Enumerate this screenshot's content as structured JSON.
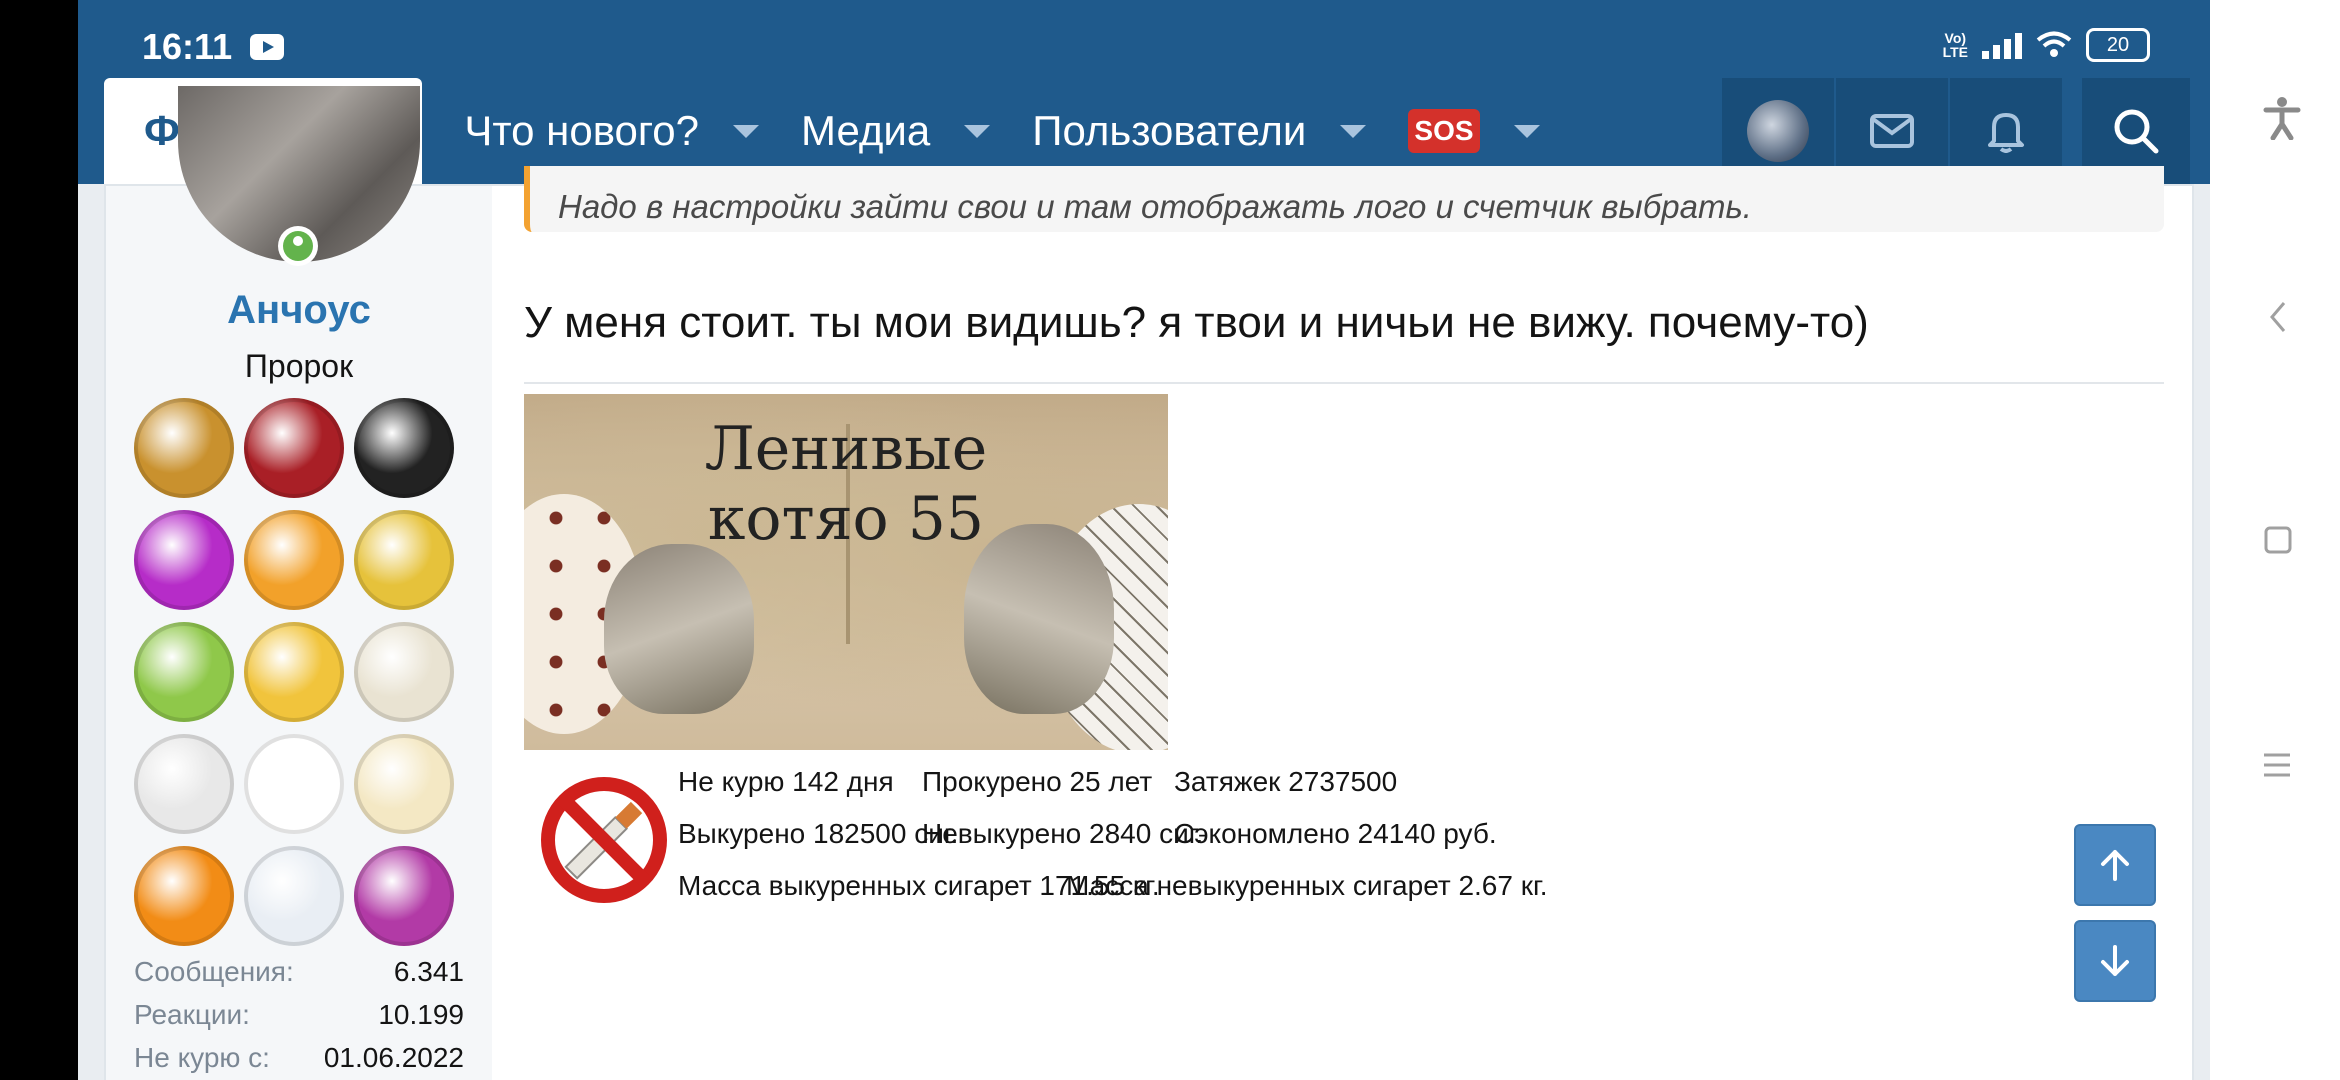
{
  "status_bar": {
    "time": "16:11",
    "network": "Vo) LTE",
    "battery": "20"
  },
  "nav": {
    "forums": "Форумы",
    "whats_new": "Что нового?",
    "media": "Медиа",
    "users": "Пользователи",
    "sos": "SOS"
  },
  "user": {
    "name": "Анчоус",
    "title": "Пророк",
    "stats": [
      {
        "label": "Сообщения:",
        "value": "6.341"
      },
      {
        "label": "Реакции:",
        "value": "10.199"
      },
      {
        "label": "Не курю с:",
        "value": "01.06.2022"
      }
    ]
  },
  "badge_colors": [
    "#c9912e",
    "#a91f26",
    "#222222",
    "#b62cc8",
    "#f2a12a",
    "#e6c23b",
    "#8fc84a",
    "#f1c43c",
    "#e9e3d2",
    "#e8e8e8",
    "#ffffff",
    "#f4e8c4",
    "#f28c16",
    "#e9eef4",
    "#b23aa6"
  ],
  "post": {
    "quote": "Надо в настройки зайти свои и там отображать лого и счетчик выбрать.",
    "text": "У меня стоит. ты мои видишь? я твои и ничьи не вижу. почему-то)"
  },
  "banner": {
    "line1": "Ленивые",
    "line2": "котяо 55"
  },
  "counter": {
    "r1c1": "Не курю 142 дня",
    "r1c2": "Прокурено 25 лет",
    "r1c3": "Затяжек 2737500",
    "r2c1": "Выкурено 182500 сиг.",
    "r2c2": "Невыкурено 2840 сиг.",
    "r2c3": "Сэкономлено 24140 руб.",
    "r3c1": "Масса выкуренных сигарет 171.55 кг.",
    "r3c2": "Масса невыкуренных сигарет 2.67 кг."
  }
}
